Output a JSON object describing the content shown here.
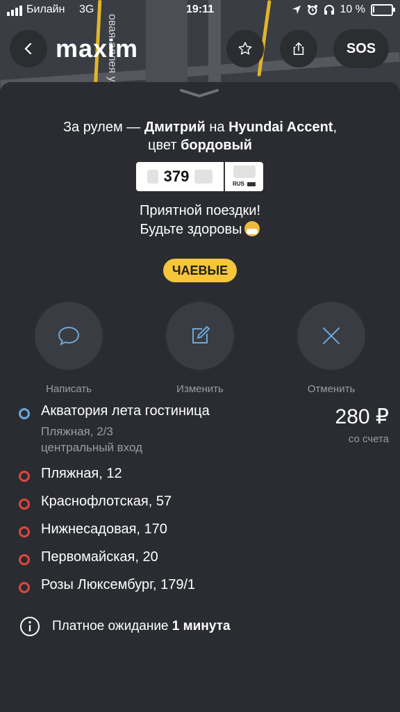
{
  "status_bar": {
    "carrier": "Билайн",
    "network": "3G",
    "time": "19:11",
    "battery": "10 %",
    "battery_level": 0.1
  },
  "map": {
    "street_label": "овая-аллея ули"
  },
  "header": {
    "logo": "maxim",
    "sos_label": "SOS",
    "icons": [
      "chevron-left-icon",
      "star-icon",
      "share-icon"
    ]
  },
  "driver": {
    "prefix": "За рулем — ",
    "name": "Дмитрий",
    "on": " на ",
    "car": "Hyundai Accent",
    "color_prefix": "цвет ",
    "color": "бордовый"
  },
  "plate": {
    "number": "379",
    "region_label": "RUS"
  },
  "greeting": {
    "line1": "Приятной поездки!",
    "line2": "Будьте здоровы"
  },
  "tips_label": "ЧАЕВЫЕ",
  "actions": [
    {
      "label": "Написать",
      "icon": "chat-icon"
    },
    {
      "label": "Изменить",
      "icon": "edit-icon"
    },
    {
      "label": "Отменить",
      "icon": "close-icon"
    }
  ],
  "route": {
    "origin": {
      "title": "Акватория лета гостиница",
      "line2": "Пляжная, 2/3",
      "line3": "центральный вход"
    },
    "stops": [
      "Пляжная, 12",
      "Краснофлотская, 57",
      "Нижнесадовая, 170",
      "Первомайская, 20",
      "Розы Люксембург, 179/1"
    ]
  },
  "price": {
    "amount": "280 ₽",
    "note": "со счета"
  },
  "waiting": {
    "text": "Платное ожидание ",
    "value": "1 минута"
  },
  "colors": {
    "background": "#2a2c31",
    "accent_yellow": "#f5c63b",
    "origin_dot": "#6fa7d9",
    "stop_dot": "#e0473e"
  }
}
